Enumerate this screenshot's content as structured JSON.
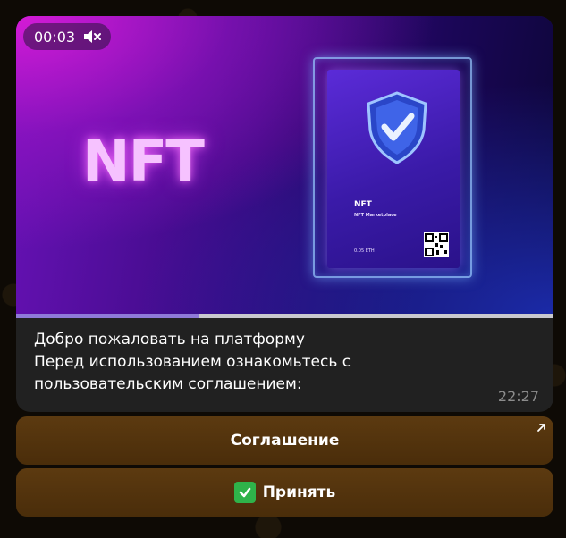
{
  "video": {
    "duration": "00:03",
    "muted_icon": "mute-icon",
    "progress_fraction": 0.34,
    "nft_logo": "NFT",
    "card": {
      "title": "NFT",
      "subtitle": "NFT Marketplace",
      "price": "0.05 ETH",
      "shield_icon": "shield-check-icon",
      "qr_icon": "qr-code-icon"
    }
  },
  "message": {
    "lines": [
      "Добро пожаловать на платформу",
      "Перед использованием ознакомьтесь с",
      "пользовательским соглашением:"
    ],
    "time": "22:27"
  },
  "buttons": {
    "agreement_label": "Соглашение",
    "agreement_icon": "external-link-icon",
    "accept_label": "Принять",
    "accept_icon": "check-mark-icon"
  },
  "colors": {
    "button_bg": "#52330c",
    "progress_fill": "#8f7ad9",
    "bubble_bg": "#212121",
    "check_green": "#2fb34a"
  }
}
